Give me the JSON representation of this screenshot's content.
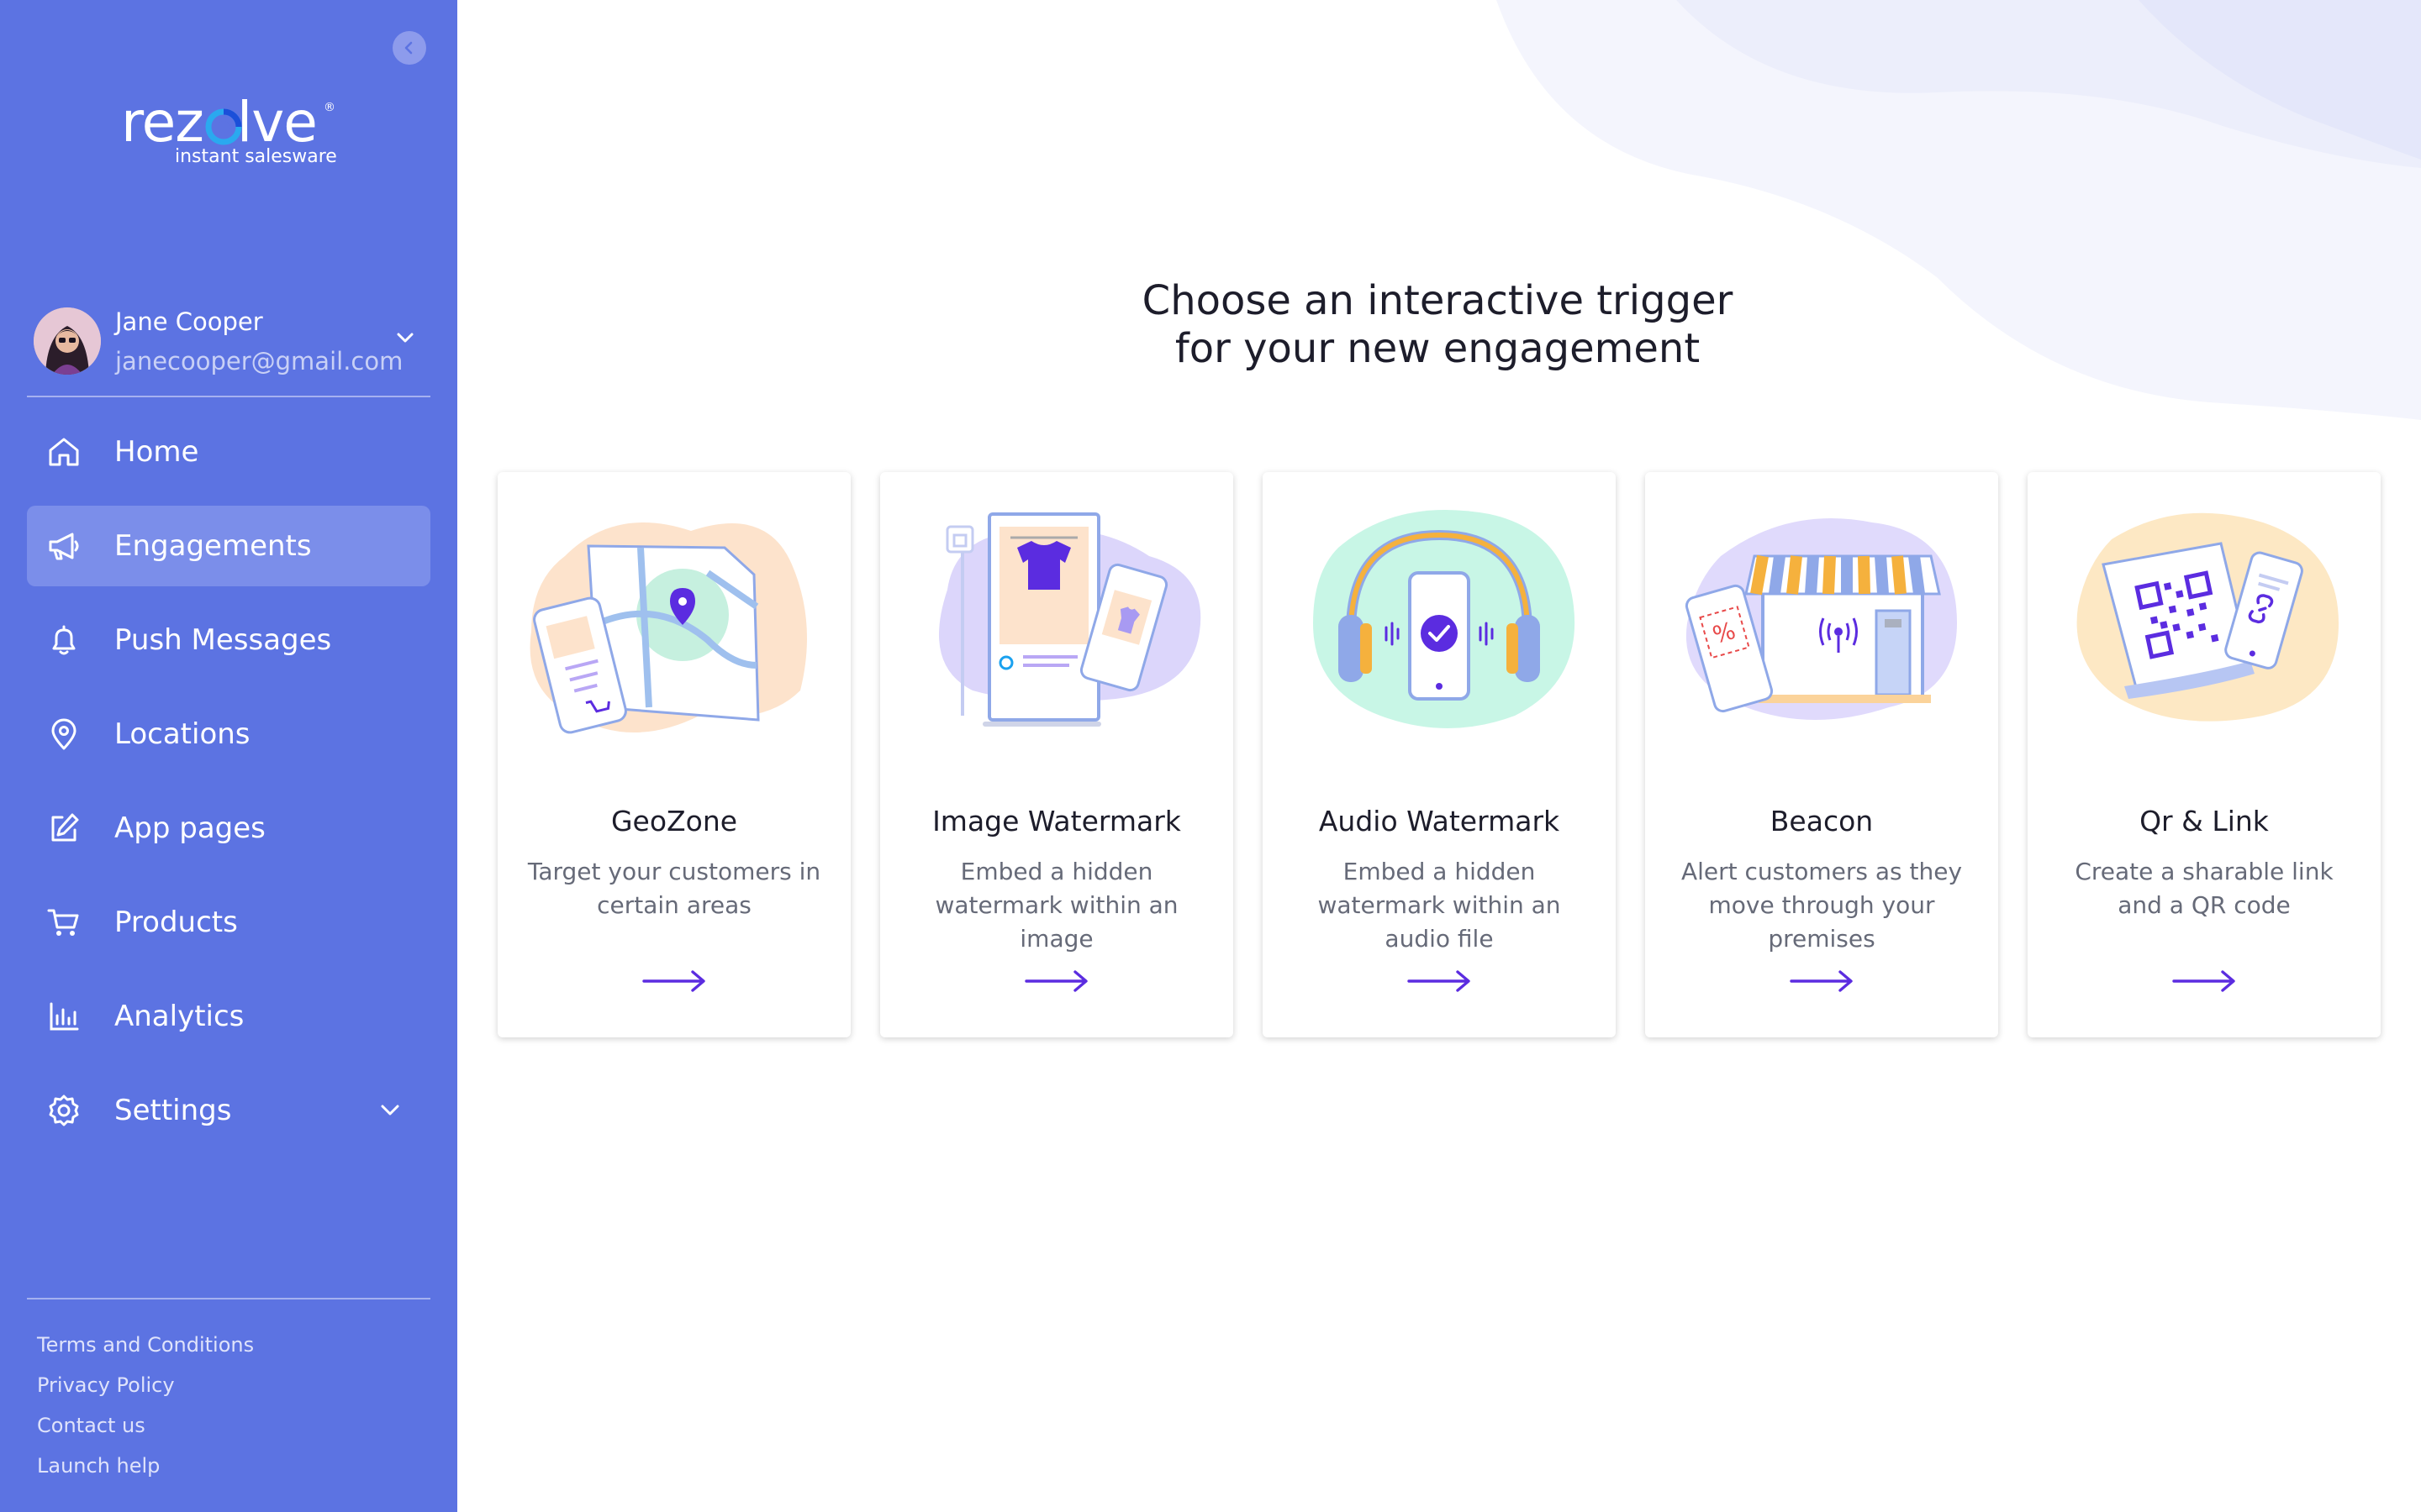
{
  "brand": {
    "logo_text": "rezolve",
    "tagline": "instant salesware",
    "colors": {
      "sidebar": "#5c73e2",
      "accent": "#5b2ce0",
      "active_item": "#7b8eea"
    }
  },
  "user": {
    "name": "Jane Cooper",
    "email": "janecooper@gmail.com"
  },
  "nav": {
    "items": [
      {
        "label": "Home",
        "icon": "home-icon"
      },
      {
        "label": "Engagements",
        "icon": "megaphone-icon",
        "active": true
      },
      {
        "label": "Push Messages",
        "icon": "bell-icon"
      },
      {
        "label": "Locations",
        "icon": "location-pin-icon"
      },
      {
        "label": "App pages",
        "icon": "edit-icon"
      },
      {
        "label": "Products",
        "icon": "cart-icon"
      },
      {
        "label": "Analytics",
        "icon": "bar-chart-icon"
      },
      {
        "label": "Settings",
        "icon": "gear-icon",
        "expandable": true
      }
    ]
  },
  "footer": {
    "links": [
      "Terms and Conditions",
      "Privacy Policy",
      "Contact us",
      "Launch help"
    ]
  },
  "main": {
    "headline_line1": "Choose an interactive trigger",
    "headline_line2": "for your new engagement",
    "cards": [
      {
        "title": "GeoZone",
        "desc": "Target your customers in certain areas",
        "icon": "map-illustration"
      },
      {
        "title": "Image Watermark",
        "desc": "Embed a hidden watermark within an image",
        "icon": "poster-illustration"
      },
      {
        "title": "Audio Watermark",
        "desc": "Embed a hidden watermark within an audio file",
        "icon": "headphones-illustration"
      },
      {
        "title": "Beacon",
        "desc": "Alert customers as they move through your premises",
        "icon": "storefront-illustration"
      },
      {
        "title": "Qr & Link",
        "desc": "Create a sharable link and a QR code",
        "icon": "qr-code-illustration"
      }
    ]
  }
}
